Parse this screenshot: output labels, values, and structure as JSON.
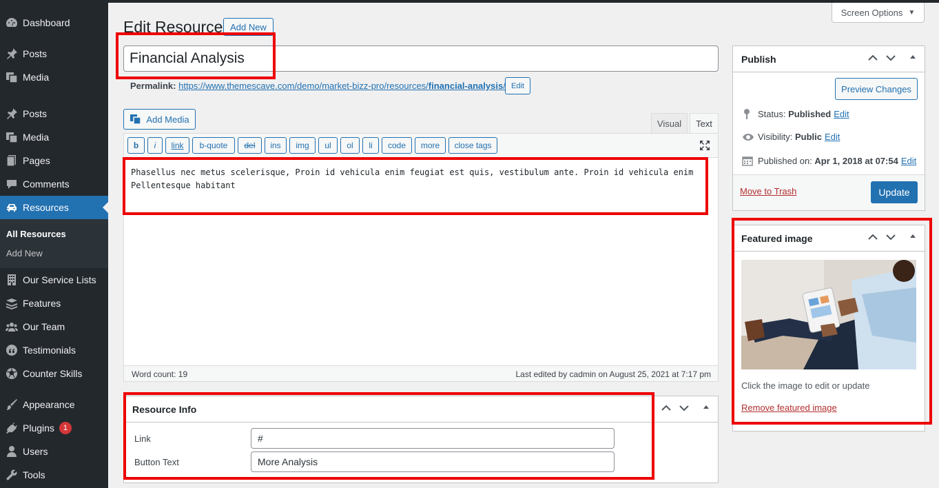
{
  "sidebar": {
    "items": [
      {
        "label": "Dashboard",
        "icon": "dashboard-icon"
      },
      {
        "label": "Posts",
        "icon": "pin-icon"
      },
      {
        "label": "Media",
        "icon": "media-icon"
      },
      {
        "label": "Posts",
        "icon": "pin-icon"
      },
      {
        "label": "Media",
        "icon": "media-icon"
      },
      {
        "label": "Pages",
        "icon": "pages-icon"
      },
      {
        "label": "Comments",
        "icon": "comment-icon"
      },
      {
        "label": "Resources",
        "icon": "car-icon"
      },
      {
        "label": "Our Service Lists",
        "icon": "building-icon"
      },
      {
        "label": "Features",
        "icon": "stack-icon"
      },
      {
        "label": "Our Team",
        "icon": "team-icon"
      },
      {
        "label": "Testimonials",
        "icon": "quote-icon"
      },
      {
        "label": "Counter Skills",
        "icon": "soccer-icon"
      },
      {
        "label": "Appearance",
        "icon": "brush-icon"
      },
      {
        "label": "Plugins",
        "icon": "plugin-icon",
        "badge": "1"
      },
      {
        "label": "Users",
        "icon": "user-icon"
      },
      {
        "label": "Tools",
        "icon": "wrench-icon"
      }
    ],
    "submenu": [
      "All Resources",
      "Add New"
    ]
  },
  "header": {
    "title": "Edit Resource",
    "add_new": "Add New",
    "screen_options": "Screen Options"
  },
  "post": {
    "title": "Financial Analysis",
    "permalink_label": "Permalink:",
    "permalink_base": "https://www.themescave.com/demo/market-bizz-pro/resources/",
    "permalink_slug": "financial-analysis",
    "permalink_end": "/",
    "permalink_edit": "Edit"
  },
  "editor": {
    "add_media": "Add Media",
    "tab_visual": "Visual",
    "tab_text": "Text",
    "buttons": [
      "b",
      "i",
      "link",
      "b-quote",
      "del",
      "ins",
      "img",
      "ul",
      "ol",
      "li",
      "code",
      "more",
      "close tags"
    ],
    "content": "Phasellus nec metus scelerisque, Proin id vehicula enim feugiat est quis, vestibulum ante. Proin id vehicula enim Pellentesque habitant",
    "word_count": "Word count: 19",
    "last_edited": "Last edited by cadmin on August 25, 2021 at 7:17 pm"
  },
  "resource_info": {
    "title": "Resource Info",
    "link_label": "Link",
    "link_value": "#",
    "button_text_label": "Button Text",
    "button_text_value": "More Analysis"
  },
  "publish": {
    "title": "Publish",
    "preview": "Preview Changes",
    "status_label": "Status:",
    "status_value": "Published",
    "visibility_label": "Visibility:",
    "visibility_value": "Public",
    "published_label": "Published on:",
    "published_value": "Apr 1, 2018 at 07:54",
    "edit": "Edit",
    "trash": "Move to Trash",
    "update": "Update"
  },
  "featured": {
    "title": "Featured image",
    "hint": "Click the image to edit or update",
    "remove": "Remove featured image"
  },
  "colors": {
    "accent": "#2271b1",
    "annotation": "#ee0000",
    "sidebar": "#23282d"
  }
}
